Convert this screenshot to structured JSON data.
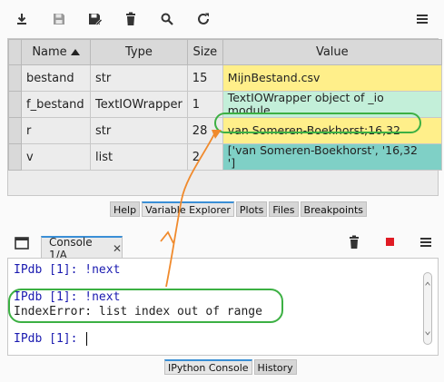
{
  "toolbar": {
    "icons": [
      "import-icon",
      "save-icon",
      "save-as-icon",
      "delete-icon",
      "search-icon",
      "refresh-icon",
      "menu-icon"
    ]
  },
  "variable_explorer": {
    "columns": [
      "Name",
      "Type",
      "Size",
      "Value"
    ],
    "rows": [
      {
        "name": "bestand",
        "type": "str",
        "size": "15",
        "value": "MijnBestand.csv",
        "color": "#ffef8a"
      },
      {
        "name": "f_bestand",
        "type": "TextIOWrapper",
        "size": "1",
        "value_line1": "TextIOWrapper object of _io",
        "value_line2": "module",
        "color": "#c3efd9"
      },
      {
        "name": "r",
        "type": "str",
        "size": "28",
        "value": "van Someren-Boekhorst;16,32",
        "color": "#ffef8a"
      },
      {
        "name": "v",
        "type": "list",
        "size": "2",
        "value_line1": "['van Someren-Boekhorst', '16,32",
        "value_line2": "']",
        "color": "#7fd0c6"
      }
    ]
  },
  "top_tabs": [
    "Help",
    "Variable Explorer",
    "Plots",
    "Files",
    "Breakpoints"
  ],
  "top_active_tab": "Variable Explorer",
  "console": {
    "tab_label": "Console 1/A",
    "tab_close": "✕",
    "lines": [
      {
        "prompt": "IPdb [1]: ",
        "text": "!next"
      },
      {
        "prompt": "IPdb [1]: ",
        "text": "!next"
      },
      {
        "prompt": "",
        "text": "IndexError: list index out of range"
      },
      {
        "prompt": "IPdb [1]: ",
        "text": ""
      }
    ]
  },
  "bottom_tabs": [
    "IPython Console",
    "History"
  ],
  "colors": {
    "highlight": "#3cb043",
    "arrow": "#f08a2c",
    "stop": "#e01b24",
    "prompt": "#1a1ab0"
  }
}
